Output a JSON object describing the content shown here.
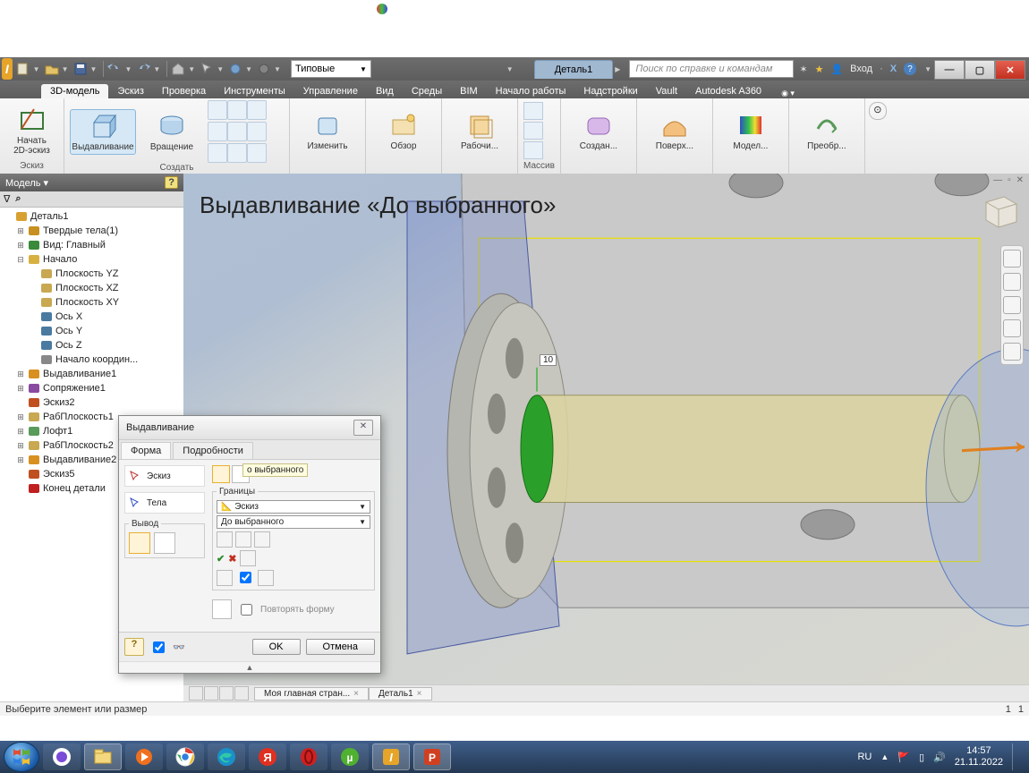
{
  "window": {
    "style_dropdown": "Типовые",
    "doc_tab": "Деталь1",
    "search_placeholder": "Поиск по справке и командам",
    "login": "Вход"
  },
  "ribbon_tabs": [
    "3D-модель",
    "Эскиз",
    "Проверка",
    "Инструменты",
    "Управление",
    "Вид",
    "Среды",
    "BIM",
    "Начало работы",
    "Надстройки",
    "Vault",
    "Autodesk A360"
  ],
  "ribbon": {
    "sketch_btn": "Начать\n2D-эскиз",
    "sketch_panel": "Эскиз",
    "extrude": "Выдавливание",
    "revolve": "Вращение",
    "create_panel": "Создать",
    "modify": "Изменить",
    "explore": "Обзор",
    "workfeat": "Рабочи...",
    "pattern": "Массив",
    "create_ff": "Создан...",
    "surface": "Поверх...",
    "model": "Модел...",
    "convert": "Преобр..."
  },
  "browser": {
    "header": "Модель",
    "items": [
      {
        "indent": 0,
        "tw": "",
        "icon": "part",
        "label": "Деталь1"
      },
      {
        "indent": 1,
        "tw": "+",
        "icon": "solids",
        "label": "Твердые тела(1)"
      },
      {
        "indent": 1,
        "tw": "+",
        "icon": "view",
        "label": "Вид: Главный"
      },
      {
        "indent": 1,
        "tw": "-",
        "icon": "folder",
        "label": "Начало"
      },
      {
        "indent": 2,
        "tw": "",
        "icon": "plane",
        "label": "Плоскость YZ"
      },
      {
        "indent": 2,
        "tw": "",
        "icon": "plane",
        "label": "Плоскость XZ"
      },
      {
        "indent": 2,
        "tw": "",
        "icon": "plane",
        "label": "Плоскость XY"
      },
      {
        "indent": 2,
        "tw": "",
        "icon": "axis",
        "label": "Ось X"
      },
      {
        "indent": 2,
        "tw": "",
        "icon": "axis",
        "label": "Ось Y"
      },
      {
        "indent": 2,
        "tw": "",
        "icon": "axis",
        "label": "Ось Z"
      },
      {
        "indent": 2,
        "tw": "",
        "icon": "point",
        "label": "Начало координ..."
      },
      {
        "indent": 1,
        "tw": "+",
        "icon": "extrude",
        "label": "Выдавливание1"
      },
      {
        "indent": 1,
        "tw": "+",
        "icon": "mate",
        "label": "Сопряжение1"
      },
      {
        "indent": 1,
        "tw": "",
        "icon": "sketch",
        "label": "Эскиз2"
      },
      {
        "indent": 1,
        "tw": "+",
        "icon": "wplane",
        "label": "РабПлоскость1"
      },
      {
        "indent": 1,
        "tw": "+",
        "icon": "loft",
        "label": "Лофт1"
      },
      {
        "indent": 1,
        "tw": "+",
        "icon": "wplane",
        "label": "РабПлоскость2"
      },
      {
        "indent": 1,
        "tw": "+",
        "icon": "extrude",
        "label": "Выдавливание2"
      },
      {
        "indent": 1,
        "tw": "",
        "icon": "sketch",
        "label": "Эскиз5"
      },
      {
        "indent": 1,
        "tw": "",
        "icon": "end",
        "label": "Конец детали"
      }
    ]
  },
  "overlay": "Выдавливание «До выбранного»",
  "dim_value": "10",
  "dialog": {
    "title": "Выдавливание",
    "tab_shape": "Форма",
    "tab_more": "Подробности",
    "sketch": "Эскиз",
    "bodies": "Тела",
    "output": "Вывод",
    "repeat": "Повторять форму",
    "limits": "Границы",
    "limits_sketch": "Эскиз",
    "limits_to": "До выбранного",
    "tooltip": "о выбранного",
    "ok": "OK",
    "cancel": "Отмена"
  },
  "doctabs": {
    "home": "Моя главная стран...",
    "part": "Деталь1"
  },
  "status": {
    "prompt": "Выберите элемент или размер",
    "n1": "1",
    "n2": "1"
  },
  "taskbar": {
    "lang": "RU",
    "time": "14:57",
    "date": "21.11.2022"
  }
}
